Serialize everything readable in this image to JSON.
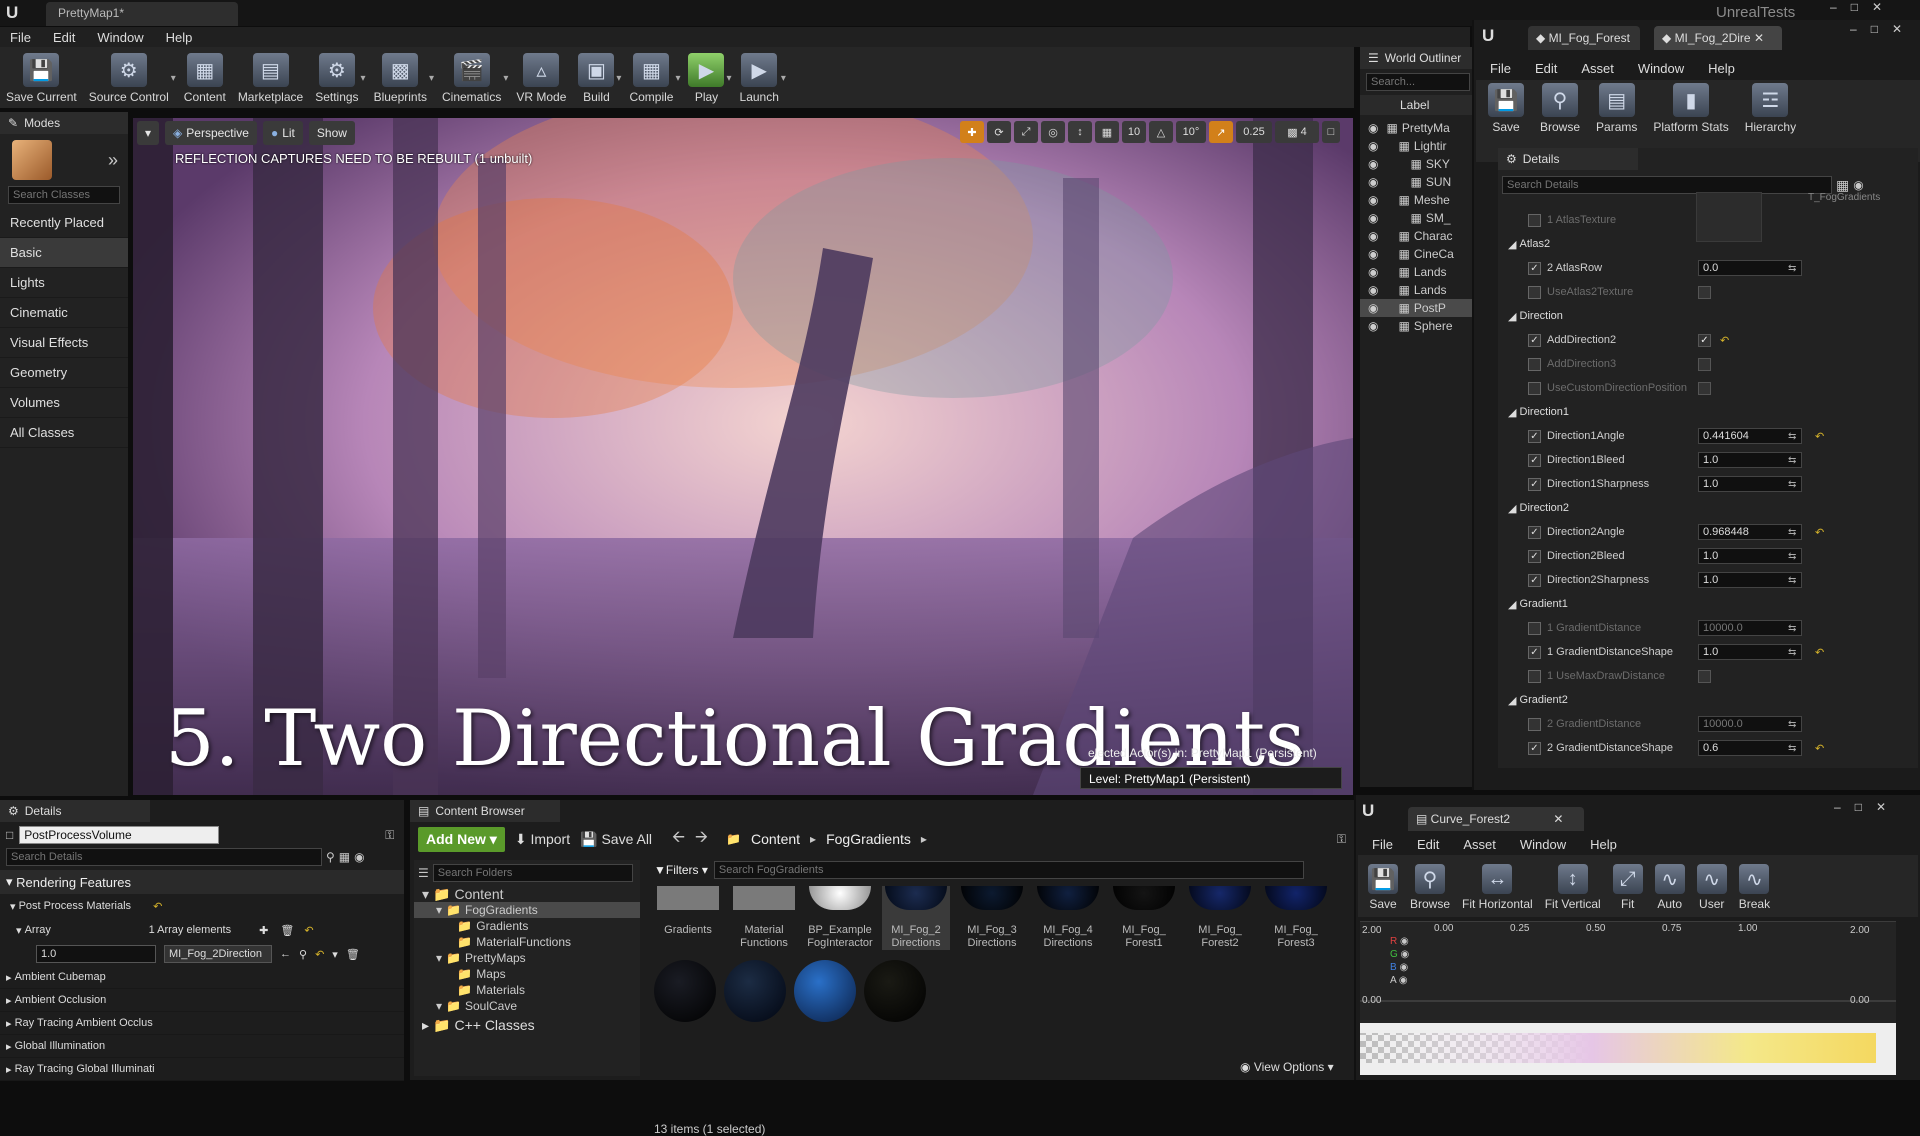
{
  "window": {
    "tab_title": "PrettyMap1*",
    "app_label": "UnrealTests"
  },
  "menu": [
    "File",
    "Edit",
    "Window",
    "Help"
  ],
  "toolbar": [
    "Save Current",
    "Source Control",
    "Content",
    "Marketplace",
    "Settings",
    "Blueprints",
    "Cinematics",
    "VR Mode",
    "Build",
    "Compile",
    "Play",
    "Launch"
  ],
  "modes": {
    "title": "Modes",
    "search_placeholder": "Search Classes",
    "categories": [
      "Recently Placed",
      "Basic",
      "Lights",
      "Cinematic",
      "Visual Effects",
      "Geometry",
      "Volumes",
      "All Classes"
    ]
  },
  "viewport": {
    "perspective": "Perspective",
    "lit": "Lit",
    "show": "Show",
    "warning": "REFLECTION CAPTURES NEED TO BE REBUILT (1 unbuilt)",
    "overlay_title": "5. Two Directional Gradients",
    "grid_snap": "10",
    "rot_snap": "10°",
    "scale_snap": "0.25",
    "cam_speed": "4",
    "selected_info": "elected Actor(s) in:  PrettyMap1 (Persistent)",
    "level": "Level:  PrettyMap1 (Persistent)"
  },
  "outliner": {
    "title": "World Outliner",
    "search_placeholder": "Search...",
    "column": "Label",
    "items": [
      "PrettyMa",
      "Lightir",
      "SKY",
      "SUN",
      "Meshe",
      "SM_",
      "Charac",
      "CineCa",
      "Lands",
      "Lands",
      "PostP",
      "Sphere"
    ]
  },
  "material_window": {
    "tabs": [
      "MI_Fog_Forest",
      "MI_Fog_2Dire"
    ],
    "menu": [
      "File",
      "Edit",
      "Asset",
      "Window",
      "Help"
    ],
    "tools": [
      "Save",
      "Browse",
      "Params",
      "Platform Stats",
      "Hierarchy"
    ],
    "details_title": "Details",
    "search_placeholder": "Search Details",
    "atlas_texture_value": "T_FogGradients",
    "rows": [
      {
        "type": "row",
        "name": "1 AtlasTexture",
        "checked": false,
        "dim": true
      },
      {
        "type": "group",
        "name": "Atlas2"
      },
      {
        "type": "row",
        "name": "2 AtlasRow",
        "checked": true,
        "value": "0.0"
      },
      {
        "type": "row",
        "name": "UseAtlas2Texture",
        "checked": false,
        "dim": true,
        "bool": false
      },
      {
        "type": "group",
        "name": "Direction"
      },
      {
        "type": "row",
        "name": "AddDirection2",
        "checked": true,
        "bool": true,
        "reset": true
      },
      {
        "type": "row",
        "name": "AddDirection3",
        "checked": false,
        "dim": true,
        "bool": false
      },
      {
        "type": "row",
        "name": "UseCustomDirectionPosition",
        "checked": false,
        "dim": true,
        "bool": false
      },
      {
        "type": "group",
        "name": "Direction1"
      },
      {
        "type": "row",
        "name": "Direction1Angle",
        "checked": true,
        "value": "0.441604",
        "reset": true
      },
      {
        "type": "row",
        "name": "Direction1Bleed",
        "checked": true,
        "value": "1.0"
      },
      {
        "type": "row",
        "name": "Direction1Sharpness",
        "checked": true,
        "value": "1.0"
      },
      {
        "type": "group",
        "name": "Direction2"
      },
      {
        "type": "row",
        "name": "Direction2Angle",
        "checked": true,
        "value": "0.968448",
        "reset": true
      },
      {
        "type": "row",
        "name": "Direction2Bleed",
        "checked": true,
        "value": "1.0"
      },
      {
        "type": "row",
        "name": "Direction2Sharpness",
        "checked": true,
        "value": "1.0"
      },
      {
        "type": "group",
        "name": "Gradient1"
      },
      {
        "type": "row",
        "name": "1 GradientDistance",
        "checked": false,
        "dim": true,
        "value": "10000.0"
      },
      {
        "type": "row",
        "name": "1 GradientDistanceShape",
        "checked": true,
        "value": "1.0",
        "reset": true
      },
      {
        "type": "row",
        "name": "1 UseMaxDrawDistance",
        "checked": false,
        "dim": true,
        "bool": false
      },
      {
        "type": "group",
        "name": "Gradient2"
      },
      {
        "type": "row",
        "name": "2 GradientDistance",
        "checked": false,
        "dim": true,
        "value": "10000.0"
      },
      {
        "type": "row",
        "name": "2 GradientDistanceShape",
        "checked": true,
        "value": "0.6",
        "reset": true
      }
    ]
  },
  "details": {
    "title": "Details",
    "actor": "PostProcessVolume",
    "search_placeholder": "Search Details",
    "section": "Rendering Features",
    "subsection": "Post Process Materials",
    "array_label": "Array",
    "array_elements": "1 Array elements",
    "element_value": "1.0",
    "element_asset": "MI_Fog_2Direction",
    "collapsed": [
      "Ambient Cubemap",
      "Ambient Occlusion",
      "Ray Tracing Ambient Occlus",
      "Global Illumination",
      "Ray Tracing Global Illuminati"
    ]
  },
  "content_browser": {
    "title": "Content Browser",
    "add_new": "Add New",
    "import": "Import",
    "save_all": "Save All",
    "path": [
      "Content",
      "FogGradients"
    ],
    "folder_search": "Search Folders",
    "filters": "Filters",
    "asset_search": "Search FogGradients",
    "tree": [
      {
        "name": "Content",
        "depth": 0
      },
      {
        "name": "FogGradients",
        "depth": 1,
        "selected": true
      },
      {
        "name": "Gradients",
        "depth": 2
      },
      {
        "name": "MaterialFunctions",
        "depth": 2
      },
      {
        "name": "PrettyMaps",
        "depth": 1
      },
      {
        "name": "Maps",
        "depth": 2
      },
      {
        "name": "Materials",
        "depth": 2
      },
      {
        "name": "SoulCave",
        "depth": 1
      }
    ],
    "cpp_classes": "C++ Classes",
    "assets": [
      "Gradients",
      "Material Functions",
      "BP_Example FogInteractor",
      "MI_Fog_2 Directions",
      "MI_Fog_3 Directions",
      "MI_Fog_4 Directions",
      "MI_Fog_ Forest1",
      "MI_Fog_ Forest2",
      "MI_Fog_ Forest3"
    ],
    "status": "13 items (1 selected)",
    "view_options": "View Options"
  },
  "curve_window": {
    "tab": "Curve_Forest2",
    "menu": [
      "File",
      "Edit",
      "Asset",
      "Window",
      "Help"
    ],
    "tools": [
      "Save",
      "Browse",
      "Fit Horizontal",
      "Fit Vertical",
      "Fit",
      "Auto",
      "User",
      "Break"
    ],
    "x_ticks": [
      "0.00",
      "0.25",
      "0.50",
      "0.75",
      "1.00"
    ],
    "y_top": "2.00",
    "y_bottom": "0.00",
    "y_top_right": "2.00",
    "y_bottom_right": "0.00",
    "channels": [
      "R",
      "G",
      "B",
      "A"
    ]
  }
}
